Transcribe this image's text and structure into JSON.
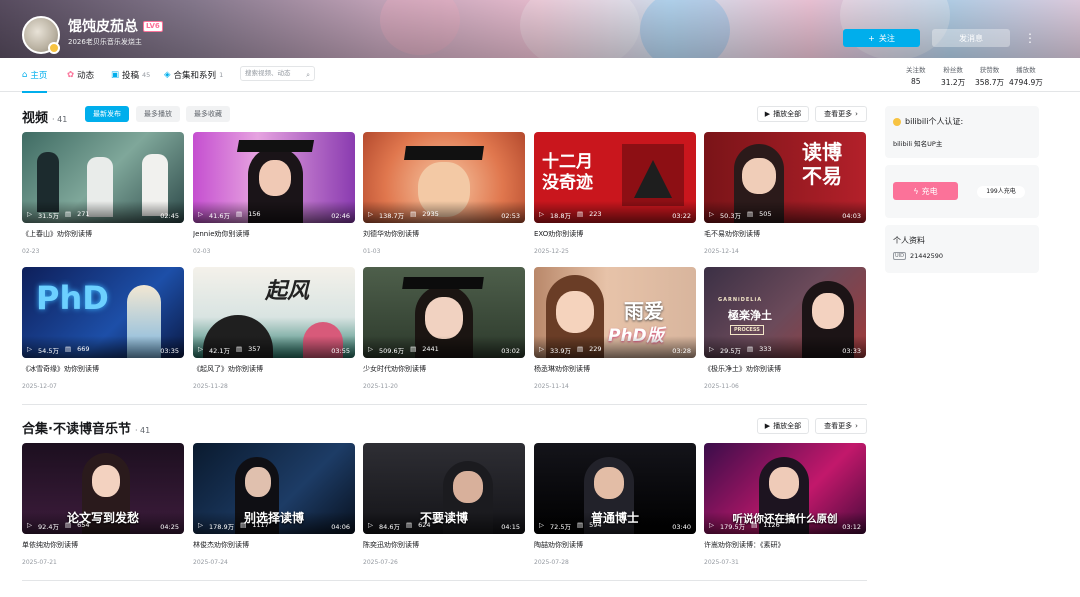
{
  "profile": {
    "name": "馄饨皮茄总",
    "level": "LV6",
    "sign": "2026老贝乐音乐发烧主",
    "follow_label": "关注",
    "message_label": "发消息",
    "more_label": "⋮"
  },
  "nav": {
    "tabs": [
      {
        "label": "主页",
        "count": ""
      },
      {
        "label": "动态",
        "count": ""
      },
      {
        "label": "投稿",
        "count": "45"
      },
      {
        "label": "合集和系列",
        "count": "1"
      }
    ],
    "search_placeholder": "搜索视频、动态"
  },
  "stats": [
    {
      "label": "关注数",
      "value": "85"
    },
    {
      "label": "粉丝数",
      "value": "31.2万"
    },
    {
      "label": "获赞数",
      "value": "358.7万"
    },
    {
      "label": "播放数",
      "value": "4794.9万"
    }
  ],
  "videos_section": {
    "title": "视频",
    "count": "41",
    "sort_tabs": [
      "最新发布",
      "最多播放",
      "最多收藏"
    ],
    "play_all": "播放全部",
    "see_more": "查看更多",
    "cards": [
      {
        "plays": "31.5万",
        "danmaku": "271",
        "duration": "02:45",
        "title": "《上春山》劝你别读博",
        "date": "02-23"
      },
      {
        "plays": "41.6万",
        "danmaku": "156",
        "duration": "02:46",
        "title": "Jennie劝你别读博",
        "date": "02-03"
      },
      {
        "plays": "138.7万",
        "danmaku": "2935",
        "duration": "02:53",
        "title": "刘德华劝你别读博",
        "date": "01-03"
      },
      {
        "plays": "18.8万",
        "danmaku": "223",
        "duration": "03:22",
        "title": "EXO劝你别读博",
        "date": "2025-12-25"
      },
      {
        "plays": "50.3万",
        "danmaku": "505",
        "duration": "04:03",
        "title": "毛不易劝你别读博",
        "date": "2025-12-14"
      },
      {
        "plays": "54.5万",
        "danmaku": "669",
        "duration": "03:35",
        "title": "《冰雪奇缘》劝你别读博",
        "date": "2025-12-07"
      },
      {
        "plays": "42.1万",
        "danmaku": "357",
        "duration": "03:55",
        "title": "《起风了》劝你别读博",
        "date": "2025-11-28"
      },
      {
        "plays": "509.6万",
        "danmaku": "2441",
        "duration": "03:02",
        "title": "少女时代劝你别读博",
        "date": "2025-11-20"
      },
      {
        "plays": "33.9万",
        "danmaku": "229",
        "duration": "03:28",
        "title": "杨丞琳劝你别读博",
        "date": "2025-11-14"
      },
      {
        "plays": "29.5万",
        "danmaku": "333",
        "duration": "03:33",
        "title": "《极乐净土》劝你别读博",
        "date": "2025-11-06"
      }
    ]
  },
  "collection_section": {
    "title": "合集·不读博音乐节",
    "count": "41",
    "play_all": "播放全部",
    "see_more": "查看更多",
    "cards": [
      {
        "plays": "92.4万",
        "danmaku": "654",
        "duration": "04:25",
        "caption": "论文写到发愁",
        "title": "单依纯劝你别读博",
        "date": "2025-07-21"
      },
      {
        "plays": "178.9万",
        "danmaku": "1117",
        "duration": "04:06",
        "caption": "别选择读博",
        "title": "林俊杰劝你别读博",
        "date": "2025-07-24"
      },
      {
        "plays": "84.6万",
        "danmaku": "624",
        "duration": "04:15",
        "caption": "不要读博",
        "title": "陈奕迅劝你别读博",
        "date": "2025-07-26"
      },
      {
        "plays": "72.5万",
        "danmaku": "594",
        "duration": "03:40",
        "caption": "普通博士",
        "title": "陶喆劝你别读博",
        "date": "2025-07-28"
      },
      {
        "plays": "179.5万",
        "danmaku": "1126",
        "duration": "03:12",
        "caption": "听说你还在搞什么原创",
        "title": "许嵩劝你别读博：《素研》",
        "date": "2025-07-31"
      }
    ]
  },
  "thumb_texts": {
    "exo": "十二月\n没奇迹",
    "mao": "读博\n不易",
    "phd": "PhD",
    "qifeng": "起风",
    "yuai": "雨爱",
    "yuai_sub": "PhD版",
    "jile": "極楽浄土",
    "jile_sub": "GARNiDELiA",
    "jile_box": "PROCESS"
  },
  "sidebar": {
    "auth_title": "bilibili个人认证:",
    "auth_desc": "bilibili 知名UP主",
    "charge_label": "充电",
    "charge_info": "199人充电",
    "info_title": "个人资料",
    "uid_tag": "UID",
    "uid": "21442590"
  },
  "colors": {
    "accent": "#00aeec",
    "pink": "#fb7299"
  }
}
